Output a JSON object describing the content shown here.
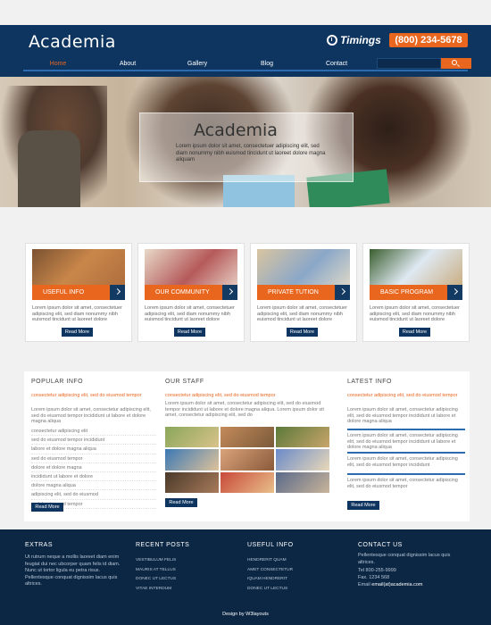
{
  "header": {
    "logo": "Academia",
    "timings_label": "Timings",
    "phone": "(800) 234-5678",
    "nav": [
      {
        "label": "Home",
        "active": true
      },
      {
        "label": "About"
      },
      {
        "label": "Gallery"
      },
      {
        "label": "Blog"
      },
      {
        "label": "Contact"
      }
    ],
    "search_placeholder": ""
  },
  "hero": {
    "title": "Academia",
    "text": "Lorem ipsum dolor sit amet, consectetuer adipiscing elit, sed diam nonummy nibh euismod tincidunt ut laoreet dolore magna aliquam"
  },
  "cards": [
    {
      "label": "USEFUL INFO",
      "text": "Lorem ipsum dolor sit amet, consectetuer adipiscing elit, sed diam nonummy nibh euismod tincidunt ut laoreet dolore",
      "more": "Read More"
    },
    {
      "label": "OUR COMMUNITY",
      "text": "Lorem ipsum dolor sit amet, consectetuer adipiscing elit, sed diam nonummy nibh euismod tincidunt ut laoreet dolore",
      "more": "Read More"
    },
    {
      "label": "PRIVATE TUTION",
      "text": "Lorem ipsum dolor sit amet, consectetuer adipiscing elit, sed diam nonummy nibh euismod tincidunt ut laoreet dolore",
      "more": "Read More"
    },
    {
      "label": "BASIC PROGRAM",
      "text": "Lorem ipsum dolor sit amet, consectetuer adipiscing elit, sed diam nonummy nibh euismod tincidunt ut laoreet dolore",
      "more": "Read More"
    }
  ],
  "popular": {
    "title": "POPULAR INFO",
    "sub": "consectetur adipiscing elit, sed do eiusmod tempor",
    "text": "Lorem ipsum dolor sit amet, consectetur adipiscing elit, sed do eiusmod tempor incididunt ut labore et dolore magna aliqua",
    "bullets": [
      "consectetur adipiscing elit",
      "sed do eiusmod tempor incididunt",
      "labore et dolore magna aliqua",
      "sed do eiusmod tempor",
      "dolore et dolore magna",
      "incididunt ut labore et dolore",
      "dolore magna aliqua",
      "adipiscing elit, sed do eiusmod",
      "sed do eiusmod tempor"
    ],
    "more": "Read More"
  },
  "staff": {
    "title": "OUR STAFF",
    "sub": "consectetur adipiscing elit, sed do eiusmod tempor",
    "text": "Lorem ipsum dolor sit amet, consectetur adipiscing elit, sed do eiusmod tempor incididunt ut labore et dolore magna aliqua. Lorem ipsum dolor sit amet, consectetur adipiscing elit, sed do",
    "more": "Read More"
  },
  "latest": {
    "title": "LATEST INFO",
    "sub": "consectetur adipiscing elit, sed do eiusmod tempor",
    "items": [
      "Lorem ipsum dolor sit amet, consectetur adipiscing elit, sed do eiusmod tempor incididunt ut labore et dolore magna aliqua",
      "Lorem ipsum dolor sit amet, consectetur adipiscing elit, sed do eiusmod tempor incididunt ut labore et dolore magna aliqua",
      "Lorem ipsum dolor sit amet, consectetur adipiscing elit, sed do eiusmod tempor incididunt",
      "Lorem ipsum dolor sit amet, consectetur adipiscing elit, sed do eiusmod tempor"
    ],
    "more": "Read More"
  },
  "footer": {
    "extras_title": "EXTRAS",
    "extras_text": "Ut rutrum neque a mollis laoreet diam enim feugiat dui nec ubcorper quam felis id diam. Nunc ut tortor ligula eu petra risus. Pellentesque conquat dignissim lacus quis altrices.",
    "recent_title": "RECENT POSTS",
    "recent_links": [
      "VESTIBULUM FELIS",
      "MAURIS AT TELLUS",
      "DONEC UT LECTUS",
      "VITAE INTERDUM"
    ],
    "useful_title": "USEFUL INFO",
    "useful_links": [
      "HENDRERIT QUAM",
      "AMET CONSECTETUR",
      "IQUAM HENDRERIT",
      "DONEC UT LECTUS"
    ],
    "contact_title": "CONTACT US",
    "contact_text": "Pellentesque conquat dignissim lacus quis altrices.",
    "tel": "Tel 800-255-9999",
    "fax": "Fax. 1234 568",
    "email_label": "Email",
    "email": "email(at)academia.com",
    "copyright": "Design by W3layouts"
  },
  "colors": {
    "navy": "#0e3560",
    "accent": "#e8661e",
    "footer": "#0c2744"
  }
}
